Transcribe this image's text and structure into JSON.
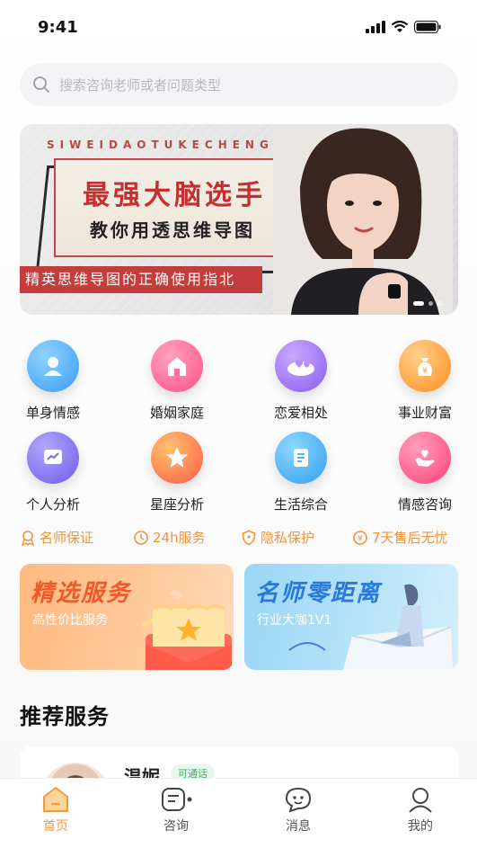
{
  "status_bar": {
    "time": "9:41"
  },
  "search": {
    "placeholder": "搜索咨询老师或者问题类型"
  },
  "banner": {
    "subtitle": "SIWEIDAOTUKECHENG",
    "title": "最强大脑选手",
    "subtitle2": "教你用透思维导图",
    "strip": "精英思维导图的正确使用指北"
  },
  "categories": [
    {
      "label": "单身情感",
      "icon": "single-user-icon",
      "color": "#5ab4f5"
    },
    {
      "label": "婚姻家庭",
      "icon": "home-icon",
      "color": "#ff6c9b"
    },
    {
      "label": "恋爱相处",
      "icon": "hearts-cloud-icon",
      "color": "#a77cf2"
    },
    {
      "label": "事业财富",
      "icon": "money-bag-icon",
      "color": "#ffa23c"
    },
    {
      "label": "个人分析",
      "icon": "chart-icon",
      "color": "#8b7cf5"
    },
    {
      "label": "星座分析",
      "icon": "star-icon",
      "color": "#ff8a4c"
    },
    {
      "label": "生活综合",
      "icon": "document-icon",
      "color": "#4fb6f2"
    },
    {
      "label": "情感咨询",
      "icon": "hand-heart-icon",
      "color": "#ff5f8f"
    }
  ],
  "guarantees": [
    {
      "label": "名师保证",
      "icon": "medal-icon"
    },
    {
      "label": "24h服务",
      "icon": "clock-icon"
    },
    {
      "label": "隐私保护",
      "icon": "shield-icon"
    },
    {
      "label": "7天售后无忧",
      "icon": "refund-icon"
    }
  ],
  "promos": [
    {
      "title": "精选服务",
      "subtitle": "高性价比服务"
    },
    {
      "title": "名师零距离",
      "subtitle": "行业大咖1V1"
    }
  ],
  "section": {
    "title": "推荐服务"
  },
  "service_card": {
    "name": "温妮",
    "badge": "可通话"
  },
  "tabbar": [
    {
      "label": "首页",
      "icon": "home-tab-icon",
      "active": true
    },
    {
      "label": "咨询",
      "icon": "chat-list-icon",
      "active": false
    },
    {
      "label": "消息",
      "icon": "message-icon",
      "active": false
    },
    {
      "label": "我的",
      "icon": "profile-icon",
      "active": false
    }
  ],
  "colors": {
    "accent": "#f39a3c",
    "guarantee": "#f0953a"
  }
}
